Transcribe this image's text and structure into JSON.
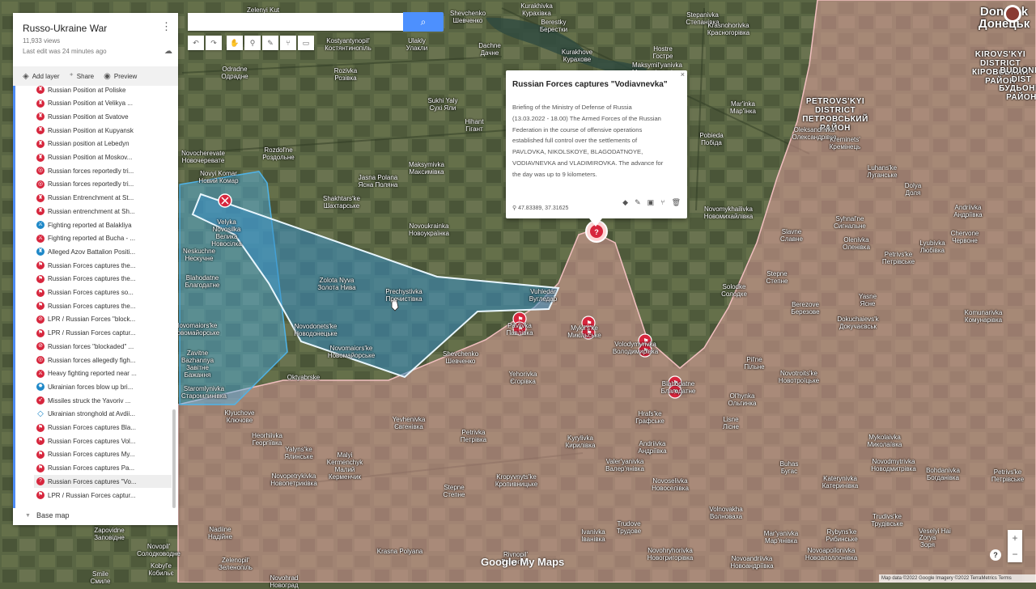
{
  "map": {
    "title": "Russo-Ukraine War",
    "views": "11,933 views",
    "last_edit": "Last edit was 24 minutes ago",
    "colors": {
      "russian_area": "#e8a1a1",
      "ukrainian_advance": "#4fb3e8",
      "marker_red": "#d7263d",
      "marker_blue": "#1e88c8"
    }
  },
  "panel_actions": {
    "add_layer": "Add layer",
    "share": "Share",
    "preview": "Preview"
  },
  "layers": [
    {
      "label": "Russian Position at Poliske",
      "color": "#d7263d",
      "icon": "tower-icon"
    },
    {
      "label": "Russian Position at Velikya ...",
      "color": "#d7263d",
      "icon": "tower-icon"
    },
    {
      "label": "Russian Position at Svatove",
      "color": "#d7263d",
      "icon": "tower-icon"
    },
    {
      "label": "Russian Position at Kupyansk",
      "color": "#d7263d",
      "icon": "tower-icon"
    },
    {
      "label": "Russian position at Lebedyn",
      "color": "#d7263d",
      "icon": "tower-icon"
    },
    {
      "label": "Russian Position at Moskov...",
      "color": "#d7263d",
      "icon": "tower-icon"
    },
    {
      "label": "Russian forces reportedly tri...",
      "color": "#d7263d",
      "icon": "target-icon"
    },
    {
      "label": "Russian forces reportedly tri...",
      "color": "#d7263d",
      "icon": "target-icon"
    },
    {
      "label": "Russian Entrenchment at St...",
      "color": "#d7263d",
      "icon": "tower-icon"
    },
    {
      "label": "Russian entrenchment at Sh...",
      "color": "#d7263d",
      "icon": "tower-icon"
    },
    {
      "label": "Fighting reported at Balakliya",
      "color": "#1e88c8",
      "icon": "crossed-swords-icon"
    },
    {
      "label": "Fighting reported at Bucha - ...",
      "color": "#d7263d",
      "icon": "crossed-swords-icon"
    },
    {
      "label": "Alleged Azov Battalion Positi...",
      "color": "#1e88c8",
      "icon": "tower-icon"
    },
    {
      "label": "Russian Forces captures the...",
      "color": "#d7263d",
      "icon": "flag-icon"
    },
    {
      "label": "Russian Forces captures the...",
      "color": "#d7263d",
      "icon": "flag-icon"
    },
    {
      "label": "Russian Forces captures so...",
      "color": "#d7263d",
      "icon": "flag-icon"
    },
    {
      "label": "Russian Forces captures the...",
      "color": "#d7263d",
      "icon": "flag-icon"
    },
    {
      "label": "LPR / Russian Forces \"block...",
      "color": "#d7263d",
      "icon": "block-icon"
    },
    {
      "label": "LPR / Russian Forces captur...",
      "color": "#d7263d",
      "icon": "flag-icon"
    },
    {
      "label": "Russian forces \"blockaded\" ...",
      "color": "#d7263d",
      "icon": "block-icon"
    },
    {
      "label": "Russian forces allegedly figh...",
      "color": "#d7263d",
      "icon": "target-icon"
    },
    {
      "label": "Heavy fighting reported near ...",
      "color": "#d7263d",
      "icon": "crossed-swords-icon"
    },
    {
      "label": "Ukrainian forces blow up bri...",
      "color": "#1e88c8",
      "icon": "explosion-icon"
    },
    {
      "label": "Missiles struck the Yavoriv ...",
      "color": "#d7263d",
      "icon": "missile-icon"
    },
    {
      "label": "Ukrainian stronghold at Avdii...",
      "color": "#1e88c8",
      "icon": "polygon-icon"
    },
    {
      "label": "Russian Forces captures Bla...",
      "color": "#d7263d",
      "icon": "flag-icon"
    },
    {
      "label": "Russian Forces captures Vol...",
      "color": "#d7263d",
      "icon": "flag-icon"
    },
    {
      "label": "Russian Forces captures My...",
      "color": "#d7263d",
      "icon": "flag-icon"
    },
    {
      "label": "Russian Forces captures Pa...",
      "color": "#d7263d",
      "icon": "flag-icon"
    },
    {
      "label": "Russian Forces captures \"Vo...",
      "color": "#d7263d",
      "icon": "question-icon",
      "selected": true
    },
    {
      "label": "LPR / Russian Forces captur...",
      "color": "#d7263d",
      "icon": "flag-icon"
    }
  ],
  "base_map": "Base map",
  "search": {
    "placeholder": "",
    "button_icon": "search-icon"
  },
  "toolbar": [
    "undo-icon",
    "redo-icon",
    "hand-icon",
    "marker-icon",
    "draw-line-icon",
    "directions-icon",
    "ruler-icon"
  ],
  "info": {
    "title": "Russian Forces captures \"Vodiavnevka\"",
    "body": "Briefing of the Ministry of Defense of Russia (13.03.2022 - 18.00) The Armed Forces of the Russian Federation in the course of offensive operations established full control over the settlements of PAVLOVKA, NIKOLSKOYE, BLAGODATNOYE, VODIAVNEVKA and VLADIMIROVKA. The advance for the day was up to 9 kilometers.",
    "coords": "47.83389, 37.31625",
    "close": "×"
  },
  "logo": "Google My Maps",
  "attribution": "Map data ©2022 Google Imagery ©2022 TerraMetrics   Terms",
  "zoom": {
    "in": "+",
    "out": "−"
  },
  "help": "?",
  "place_labels": [
    {
      "id": "donetsk",
      "lines": [
        "Donetsk",
        "Донецьк"
      ]
    },
    {
      "id": "kirovskyi",
      "lines": [
        "KIROVS'KYI",
        "DISTRICT",
        "КІРОВСЬКИЙ",
        "РАЙОН"
      ]
    },
    {
      "id": "petrovskyi",
      "lines": [
        "PETROVS'KYI",
        "DISTRICT",
        "ПЕТРОВСЬКИЙ",
        "РАЙОН"
      ]
    },
    {
      "id": "budionivskyi",
      "lines": [
        "BUDIONIV",
        "DIST",
        "БУДЬОНІВ",
        "РАЙОН"
      ]
    },
    {
      "id": "zelenyi-kut",
      "lines": [
        "Zelenyi Kut"
      ]
    },
    {
      "id": "kostiantynopil",
      "lines": [
        "Kostyantynopil'",
        "Костянтинопіль"
      ]
    },
    {
      "id": "ulakly",
      "lines": [
        "Ulakly",
        "Улакли"
      ]
    },
    {
      "id": "dachne",
      "lines": [
        "Dachne",
        "Дачне"
      ]
    },
    {
      "id": "kurakhove",
      "lines": [
        "Kurakhove",
        "Курахове"
      ]
    },
    {
      "id": "berestky",
      "lines": [
        "Berestky",
        "Берестки"
      ]
    },
    {
      "id": "stepanivka",
      "lines": [
        "Stepanivka",
        "Степанівка"
      ]
    },
    {
      "id": "sheveschenko-top",
      "lines": [
        "Shevchenko",
        "Шевченко"
      ]
    },
    {
      "id": "kurakhivka",
      "lines": [
        "Kurakhivka",
        "Курахівка"
      ]
    },
    {
      "id": "maksymilianivka-top",
      "lines": [
        "Maksymil'yanivka",
        "Максимільянівка"
      ]
    },
    {
      "id": "hostre",
      "lines": [
        "Hostre",
        "Гостре"
      ]
    },
    {
      "id": "krasnohorivka",
      "lines": [
        "Krasnohorivka",
        "Красногорівка"
      ]
    },
    {
      "id": "odradne",
      "lines": [
        "Odradne",
        "Одрадне"
      ]
    },
    {
      "id": "rozivka",
      "lines": [
        "Rozivka",
        "Розівка"
      ]
    },
    {
      "id": "sukhi-yaly",
      "lines": [
        "Sukhi Yaly",
        "Сухі Яли"
      ]
    },
    {
      "id": "hihant",
      "lines": [
        "Hihant",
        "Гігант"
      ]
    },
    {
      "id": "marinka",
      "lines": [
        "Mar'inka",
        "Мар'їнка"
      ]
    },
    {
      "id": "pobieda",
      "lines": [
        "Pobieda",
        "Побіда"
      ]
    },
    {
      "id": "oleksandrivka",
      "lines": [
        "Oleksandrivka",
        "Олександрівка"
      ]
    },
    {
      "id": "kreminets",
      "lines": [
        "Kreminets'",
        "Кремінець"
      ]
    },
    {
      "id": "novocherevate",
      "lines": [
        "Novocherevate",
        "Новочеревате"
      ]
    },
    {
      "id": "rozdolne",
      "lines": [
        "Rozdol'ne",
        "Роздольне"
      ]
    },
    {
      "id": "maksymivka",
      "lines": [
        "Maksymivka",
        "Максимівка"
      ]
    },
    {
      "id": "jasna-polana",
      "lines": [
        "Jasna Polana",
        "Ясна Поляна"
      ]
    },
    {
      "id": "novyi-komar",
      "lines": [
        "Novyi Komar",
        "Новий Комар"
      ]
    },
    {
      "id": "shakhtarske",
      "lines": [
        "Shakhtars'ke",
        "Шахтарське"
      ]
    },
    {
      "id": "luhanske",
      "lines": [
        "Luhans'ke",
        "Луганське"
      ]
    },
    {
      "id": "dolia",
      "lines": [
        "Dolya",
        "Доля"
      ]
    },
    {
      "id": "andriivka",
      "lines": [
        "Andriivka",
        "Андріївка"
      ]
    },
    {
      "id": "velyka-novosilka",
      "lines": [
        "Velyka",
        "Novosilka",
        "Велика",
        "Новосілка"
      ]
    },
    {
      "id": "novoukrainka",
      "lines": [
        "Novoukrainka",
        "Новоукраїнка"
      ]
    },
    {
      "id": "novomykhailivka",
      "lines": [
        "Novomykhailivka",
        "Новомихайлівка"
      ]
    },
    {
      "id": "syhnalne",
      "lines": [
        "Syhnal'ne",
        "Сигнальне"
      ]
    },
    {
      "id": "olenivka",
      "lines": [
        "Olenivka",
        "Оленівка"
      ]
    },
    {
      "id": "lyubivka",
      "lines": [
        "Lyubivka",
        "Любівка"
      ]
    },
    {
      "id": "chervone",
      "lines": [
        "Chervone",
        "Червоне"
      ]
    },
    {
      "id": "slavne",
      "lines": [
        "Slavne",
        "Славне"
      ]
    },
    {
      "id": "petrivske-right",
      "lines": [
        "Petrivs'ke",
        "Петрівське"
      ]
    },
    {
      "id": "neskuchne",
      "lines": [
        "Neskuchne",
        "Нескучне"
      ]
    },
    {
      "id": "blahodatne",
      "lines": [
        "Blahodatne",
        "Благодатне"
      ]
    },
    {
      "id": "zolota-nyva",
      "lines": [
        "Zolota Nyva",
        "Золота Нива"
      ]
    },
    {
      "id": "prechystivka",
      "lines": [
        "Prechystivka",
        "Пречистівка"
      ]
    },
    {
      "id": "vuhledar",
      "lines": [
        "Vuhledar",
        "Вугледар"
      ]
    },
    {
      "id": "stepne-top",
      "lines": [
        "Stepne",
        "Степне"
      ]
    },
    {
      "id": "solodke",
      "lines": [
        "Solodke",
        "Солодке"
      ]
    },
    {
      "id": "berezove",
      "lines": [
        "Berezove",
        "Березове"
      ]
    },
    {
      "id": "yasne",
      "lines": [
        "Yasne",
        "Ясне"
      ]
    },
    {
      "id": "dokuchaievsk",
      "lines": [
        "Dokuchaievs'k",
        "Докучаєвськ"
      ]
    },
    {
      "id": "komunarivka",
      "lines": [
        "Komunarivka",
        "Комунарівка"
      ]
    },
    {
      "id": "novomaiorske-left",
      "lines": [
        "Novomaiors'ke",
        "Новомайорське"
      ]
    },
    {
      "id": "novodonetske",
      "lines": [
        "Novodonets'ke",
        "Новодонецьке"
      ]
    },
    {
      "id": "novomaiorske",
      "lines": [
        "Novomaiors'ke",
        "Новомайорське"
      ]
    },
    {
      "id": "pavlivka",
      "lines": [
        "Pavlivka",
        "Павлівка"
      ]
    },
    {
      "id": "mykilske",
      "lines": [
        "Mykil's'ke",
        "Микільське"
      ]
    },
    {
      "id": "volodymyrivka",
      "lines": [
        "Volodymyrivka",
        "Володимирівка"
      ]
    },
    {
      "id": "zavitne-bazhannia",
      "lines": [
        "Zavitne",
        "Bazhannya",
        "Завітне",
        "Бажання"
      ]
    },
    {
      "id": "shevchenko",
      "lines": [
        "Shevchenko",
        "Шевченко"
      ]
    },
    {
      "id": "pilne",
      "lines": [
        "Pil'ne",
        "Пільне"
      ]
    },
    {
      "id": "novotroitske",
      "lines": [
        "Novotroits'ke",
        "Новотроїцьке"
      ]
    },
    {
      "id": "okt-abrske",
      "lines": [
        "Oktyabrske"
      ]
    },
    {
      "id": "yehorivka",
      "lines": [
        "Yehorivka",
        "Єгорівка"
      ]
    },
    {
      "id": "blahodatne-right",
      "lines": [
        "Blahodatne",
        "Благодатне"
      ]
    },
    {
      "id": "olhynka",
      "lines": [
        "Ol'hynka",
        "Ольгинка"
      ]
    },
    {
      "id": "staromlynivka",
      "lines": [
        "Staromlynivka",
        "Старомлинівка"
      ]
    },
    {
      "id": "kliuchove",
      "lines": [
        "Klyuchove",
        "Ключове"
      ]
    },
    {
      "id": "hrafske",
      "lines": [
        "Hrafs'ke",
        "Графське"
      ]
    },
    {
      "id": "lisne",
      "lines": [
        "Lisne",
        "Лісне"
      ]
    },
    {
      "id": "heorhiivka",
      "lines": [
        "Heorhiivka",
        "Георгіївка"
      ]
    },
    {
      "id": "yevhenivka",
      "lines": [
        "Yevhenivka",
        "Євгенівка"
      ]
    },
    {
      "id": "petrivka",
      "lines": [
        "Petrivka",
        "Петрівка"
      ]
    },
    {
      "id": "kyrylivka",
      "lines": [
        "Kyrylivka",
        "Кирилівка"
      ]
    },
    {
      "id": "andriivka-bot",
      "lines": [
        "Andriivka",
        "Андріївка"
      ]
    },
    {
      "id": "mykolaivka",
      "lines": [
        "Mykolaivka",
        "Миколаївка"
      ]
    },
    {
      "id": "novodmytrivka",
      "lines": [
        "Novodmytrivka",
        "Новодмитрівка"
      ]
    },
    {
      "id": "yalyns-ke",
      "lines": [
        "Yalyns'ke",
        "Ялинське"
      ]
    },
    {
      "id": "valeryanivka",
      "lines": [
        "Valer'yanivka",
        "Валер'янівка"
      ]
    },
    {
      "id": "kermenchyk",
      "lines": [
        "Malyi",
        "Kermenchyk",
        "Малий",
        "Керменчик"
      ]
    },
    {
      "id": "buhas",
      "lines": [
        "Buhas",
        "Бугас"
      ]
    },
    {
      "id": "ekaterynivka",
      "lines": [
        "Katerynivka",
        "Катеринівка"
      ]
    },
    {
      "id": "bohdanivka",
      "lines": [
        "Bohdanivka",
        "Богданівка"
      ]
    },
    {
      "id": "petrivske-br",
      "lines": [
        "Petrivs'ke",
        "Петрівське"
      ]
    },
    {
      "id": "novopetrykivka",
      "lines": [
        "Novopetrykivka",
        "Новопетриківка"
      ]
    },
    {
      "id": "stepne-bot",
      "lines": [
        "Stepne",
        "Степне"
      ]
    },
    {
      "id": "kropyvnytske",
      "lines": [
        "Kropyvnyts'ke",
        "Кропивницьке"
      ]
    },
    {
      "id": "novoselivka",
      "lines": [
        "Novoselivka",
        "Новоселівка"
      ]
    },
    {
      "id": "volnovakha",
      "lines": [
        "Volnovakha",
        "Волноваха"
      ]
    },
    {
      "id": "trudivske",
      "lines": [
        "Trudivs'ke",
        "Трудівське"
      ]
    },
    {
      "id": "rybynske",
      "lines": [
        "Rybyns'ke",
        "Рибинське"
      ]
    },
    {
      "id": "ivanivka",
      "lines": [
        "Ivanivka",
        "Іванівка"
      ]
    },
    {
      "id": "trudove",
      "lines": [
        "Trudove",
        "Трудове"
      ]
    },
    {
      "id": "nadiine",
      "lines": [
        "Nadiine",
        "Надійне"
      ]
    },
    {
      "id": "zapovidne",
      "lines": [
        "Zapovidne",
        "Заповідне"
      ]
    },
    {
      "id": "solodkovane",
      "lines": [
        "Novopil'",
        "Солодководне"
      ]
    },
    {
      "id": "zelenopil",
      "lines": [
        "Zelenopil'",
        "Зеленопіль"
      ]
    },
    {
      "id": "kolyubivka",
      "lines": [
        "Kobyl'e",
        "Кобильє"
      ]
    },
    {
      "id": "smile",
      "lines": [
        "Smile",
        "Смиле"
      ]
    },
    {
      "id": "novohrad",
      "lines": [
        "Novohrad",
        "Новоград"
      ]
    },
    {
      "id": "rivnopil",
      "lines": [
        "Rivnopil'",
        "Рівнопіль"
      ]
    },
    {
      "id": "kasna-polana",
      "lines": [
        "Krasna Polyana"
      ]
    },
    {
      "id": "novohryhorivka",
      "lines": [
        "Novohryhorivka",
        "Новогригорівка"
      ]
    },
    {
      "id": "novoandriivka",
      "lines": [
        "Novoandriivka",
        "Новоандріївка"
      ]
    },
    {
      "id": "novoapolonivka",
      "lines": [
        "Novoapollonivka",
        "Новоаполлонівка"
      ]
    },
    {
      "id": "voloshka",
      "lines": [
        "Veselyi Hai"
      ]
    },
    {
      "id": "mariinka-bot",
      "lines": [
        "Mar'yanivka",
        "Мар'янівка"
      ]
    },
    {
      "id": "zoria",
      "lines": [
        "Zorya",
        "Зоря"
      ]
    }
  ]
}
